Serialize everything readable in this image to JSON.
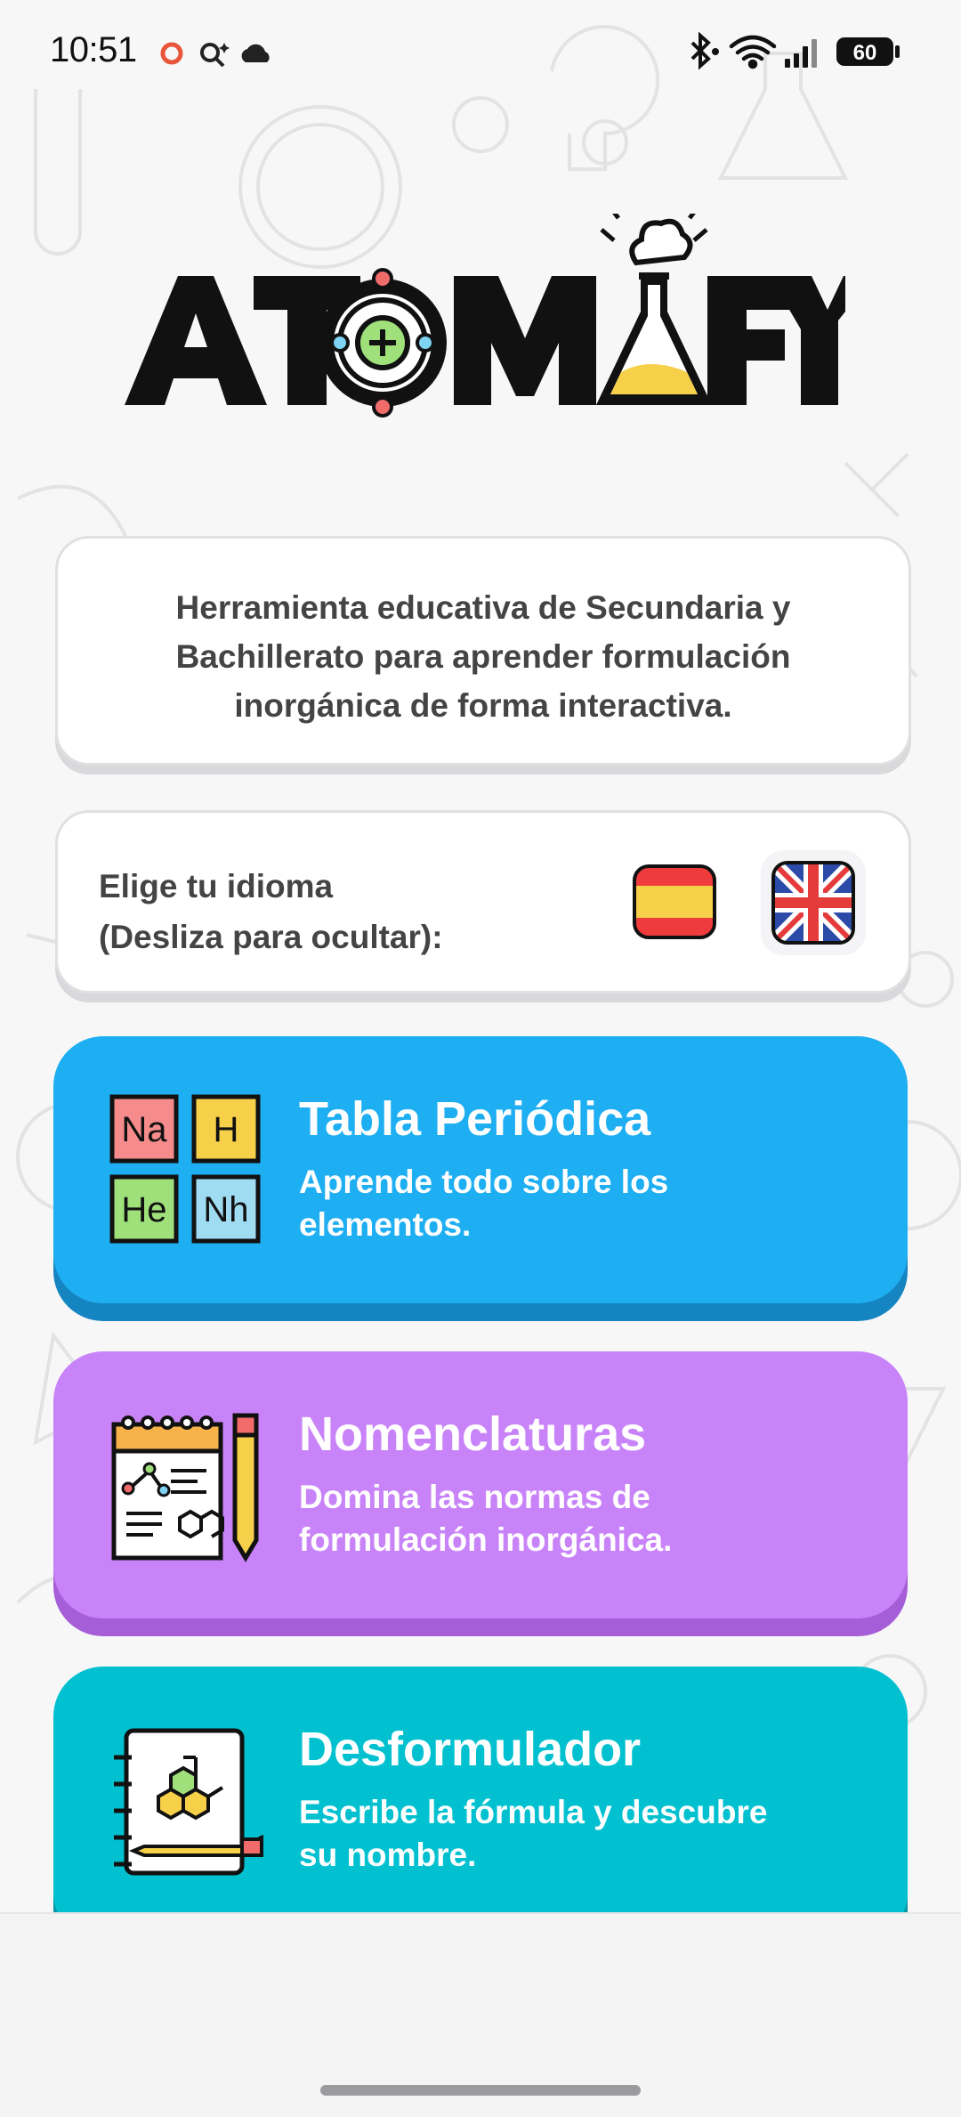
{
  "status_bar": {
    "time": "10:51",
    "battery": "60",
    "left_icons": [
      "recording-dot-icon",
      "search-sparkle-icon",
      "cloud-icon"
    ],
    "right_icons": [
      "bluetooth-icon",
      "wifi-icon",
      "signal-icon",
      "battery-icon"
    ]
  },
  "logo": {
    "text": "ATOMIFY"
  },
  "description": {
    "line1": "Herramienta educativa de Secundaria y",
    "line2": "Bachillerato para aprender formulación",
    "line3": "inorgánica de forma interactiva."
  },
  "language": {
    "line1": "Elige tu idioma",
    "line2": "(Desliza para ocultar):",
    "options": [
      "spanish-flag-icon",
      "uk-flag-icon"
    ]
  },
  "menu": [
    {
      "title": "Tabla Periódica",
      "subtitle_line1": "Aprende todo sobre los",
      "subtitle_line2": "elementos.",
      "tiles": [
        "Na",
        "H",
        "He",
        "Nh"
      ],
      "color": "#1eaef2"
    },
    {
      "title": "Nomenclaturas",
      "subtitle_line1": "Domina las normas de",
      "subtitle_line2": "formulación inorgánica.",
      "color": "#c983f9"
    },
    {
      "title": "Desformulador",
      "subtitle_line1": "Escribe la fórmula y descubre",
      "subtitle_line2": "su nombre.",
      "color": "#01c1d0"
    }
  ],
  "colors": {
    "accent_yellow": "#f7d04a",
    "accent_red": "#f26b6b",
    "accent_green": "#9fe07a",
    "accent_blue": "#7ed3f2"
  }
}
